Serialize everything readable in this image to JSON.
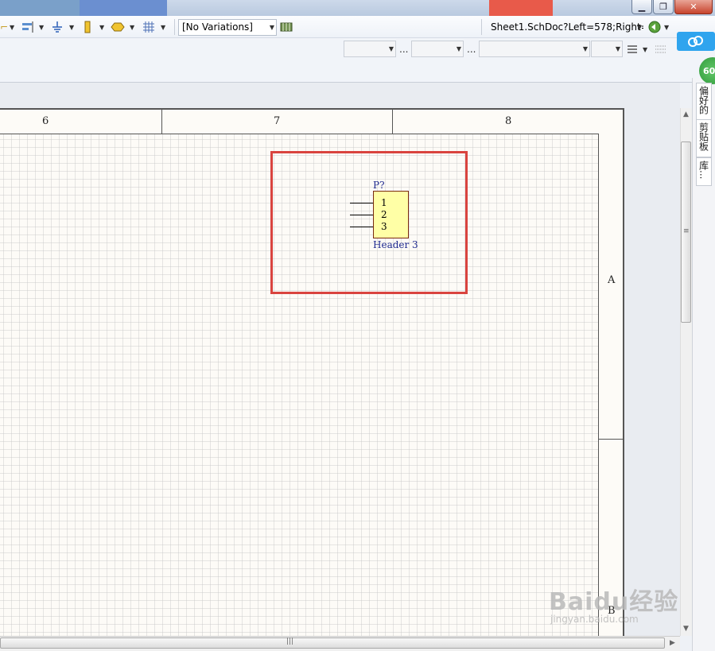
{
  "toolbar": {
    "variations_value": "[No Variations]",
    "document_path": "Sheet1.SchDoc?Left=578;Right=",
    "ellipsis_1": "...",
    "ellipsis_2": "..."
  },
  "sheet": {
    "column_labels": [
      "6",
      "7",
      "8"
    ],
    "row_labels": [
      "A",
      "B"
    ]
  },
  "component": {
    "designator": "P?",
    "comment": "Header 3",
    "pins": [
      "1",
      "2",
      "3"
    ]
  },
  "side_panel": {
    "badge": "60",
    "tabs": [
      "偏好的",
      "剪贴板",
      "库..."
    ]
  },
  "watermark": {
    "main": "Baidu经验",
    "sub": "jingyan.baidu.com"
  },
  "colors": {
    "highlight": "#d9443f",
    "component_fill": "#ffffa6",
    "text_blue": "#1f2a8f",
    "sheet_bg": "#fdfbf7"
  }
}
